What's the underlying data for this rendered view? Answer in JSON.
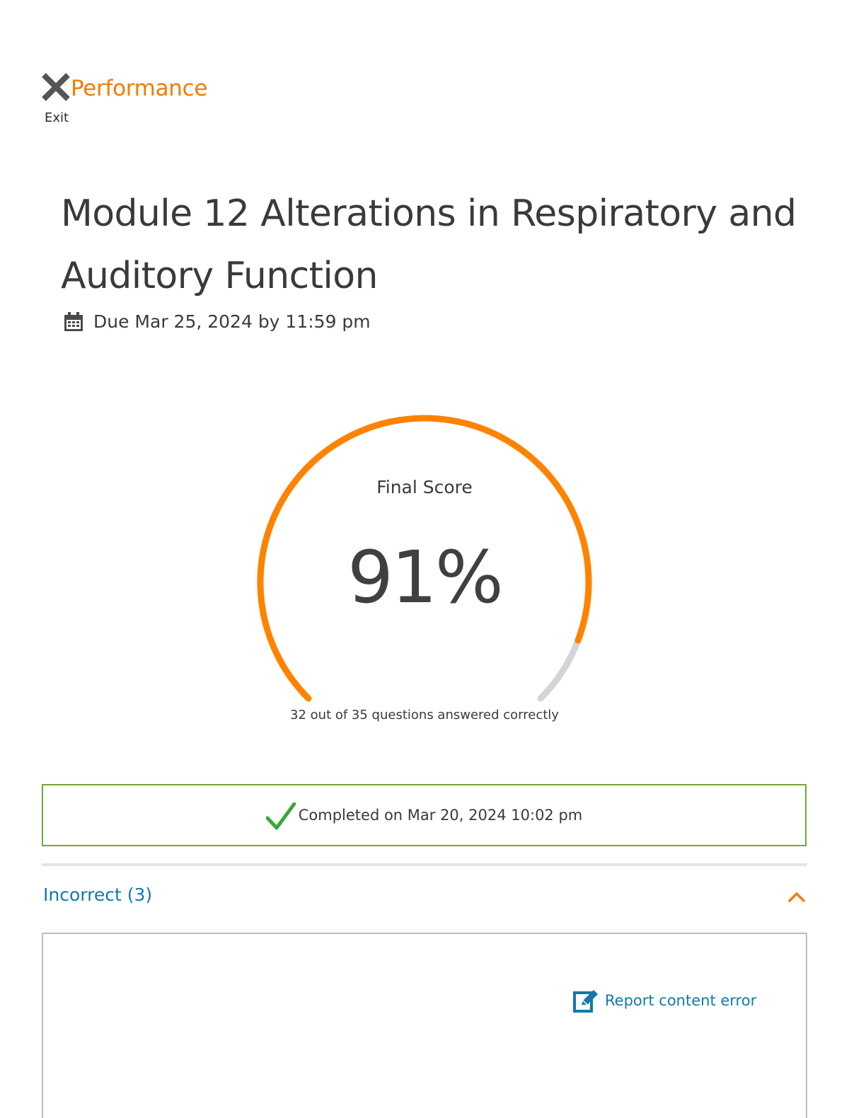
{
  "header": {
    "title": "Performance",
    "exit_label": "Exit",
    "exit_icon": "close-icon"
  },
  "assignment": {
    "title": "Module 12 Alterations in Respiratory and Auditory Function",
    "due": "Due Mar 25, 2024 by 11:59 pm",
    "due_icon": "calendar-icon"
  },
  "score": {
    "label": "Final Score",
    "value": "91%",
    "percent": 91,
    "detail": "32 out of 35 questions answered correctly"
  },
  "completion": {
    "text": "Completed on Mar 20, 2024 10:02 pm",
    "icon": "checkmark-icon"
  },
  "incorrect_section": {
    "label": "Incorrect (3)",
    "expanded": true
  },
  "question_card": {
    "report_label": "Report content error",
    "report_icon": "edit-icon"
  },
  "colors": {
    "accent_orange": "#f07d00",
    "gauge_track": "#d4d4d4",
    "success_green": "#72a835",
    "check_green": "#3aa53a",
    "link_blue": "#127aa5",
    "text": "#3a3a3a"
  }
}
